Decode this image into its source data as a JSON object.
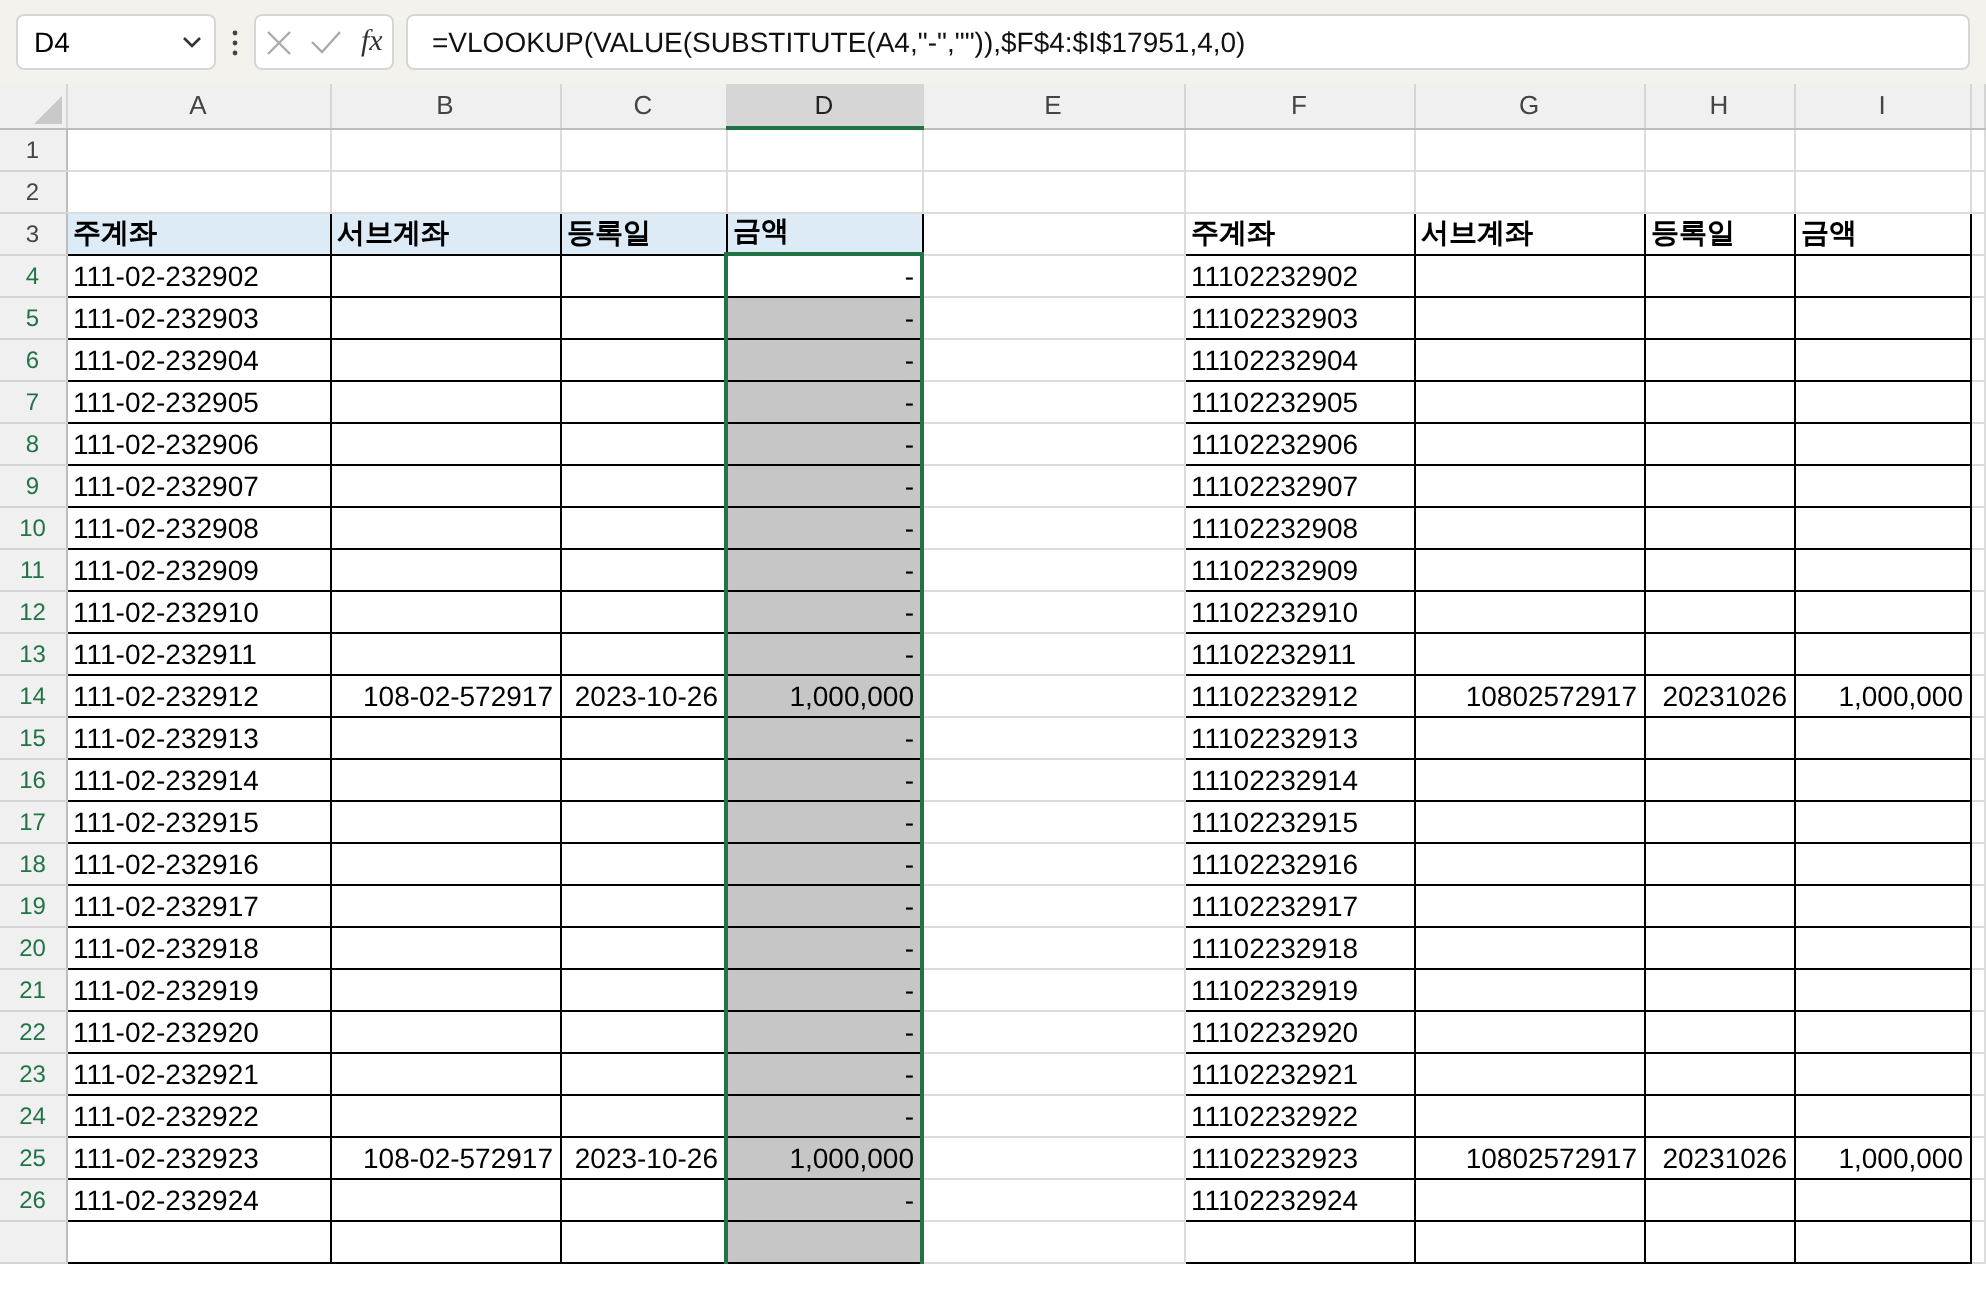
{
  "formula_bar": {
    "name_box": "D4",
    "fx_label": "fx",
    "formula": "=VLOOKUP(VALUE(SUBSTITUTE(A4,\"-\",\"\")),$F$4:$I$17951,4,0)"
  },
  "columns": [
    {
      "letter": "A",
      "selected": false
    },
    {
      "letter": "B",
      "selected": false
    },
    {
      "letter": "C",
      "selected": false
    },
    {
      "letter": "D",
      "selected": true
    },
    {
      "letter": "E",
      "selected": false
    },
    {
      "letter": "F",
      "selected": false
    },
    {
      "letter": "G",
      "selected": false
    },
    {
      "letter": "H",
      "selected": false
    },
    {
      "letter": "I",
      "selected": false
    }
  ],
  "blank_rows": [
    "1",
    "2"
  ],
  "header_row": {
    "num": "3",
    "left": [
      "주계좌",
      "서브계좌",
      "등록일",
      "금액"
    ],
    "right": [
      "주계좌",
      "서브계좌",
      "등록일",
      "금액"
    ]
  },
  "rows": [
    {
      "num": "4",
      "main": "111-02-232902",
      "sub": "",
      "date": "",
      "amount": "-",
      "selected": true,
      "active": true,
      "f": "11102232902",
      "g": "",
      "h": "",
      "i": ""
    },
    {
      "num": "5",
      "main": "111-02-232903",
      "sub": "",
      "date": "",
      "amount": "-",
      "selected": true,
      "active": false,
      "f": "11102232903",
      "g": "",
      "h": "",
      "i": ""
    },
    {
      "num": "6",
      "main": "111-02-232904",
      "sub": "",
      "date": "",
      "amount": "-",
      "selected": true,
      "active": false,
      "f": "11102232904",
      "g": "",
      "h": "",
      "i": ""
    },
    {
      "num": "7",
      "main": "111-02-232905",
      "sub": "",
      "date": "",
      "amount": "-",
      "selected": true,
      "active": false,
      "f": "11102232905",
      "g": "",
      "h": "",
      "i": ""
    },
    {
      "num": "8",
      "main": "111-02-232906",
      "sub": "",
      "date": "",
      "amount": "-",
      "selected": true,
      "active": false,
      "f": "11102232906",
      "g": "",
      "h": "",
      "i": ""
    },
    {
      "num": "9",
      "main": "111-02-232907",
      "sub": "",
      "date": "",
      "amount": "-",
      "selected": true,
      "active": false,
      "f": "11102232907",
      "g": "",
      "h": "",
      "i": ""
    },
    {
      "num": "10",
      "main": "111-02-232908",
      "sub": "",
      "date": "",
      "amount": "-",
      "selected": true,
      "active": false,
      "f": "11102232908",
      "g": "",
      "h": "",
      "i": ""
    },
    {
      "num": "11",
      "main": "111-02-232909",
      "sub": "",
      "date": "",
      "amount": "-",
      "selected": true,
      "active": false,
      "f": "11102232909",
      "g": "",
      "h": "",
      "i": ""
    },
    {
      "num": "12",
      "main": "111-02-232910",
      "sub": "",
      "date": "",
      "amount": "-",
      "selected": true,
      "active": false,
      "f": "11102232910",
      "g": "",
      "h": "",
      "i": ""
    },
    {
      "num": "13",
      "main": "111-02-232911",
      "sub": "",
      "date": "",
      "amount": "-",
      "selected": true,
      "active": false,
      "f": "11102232911",
      "g": "",
      "h": "",
      "i": ""
    },
    {
      "num": "14",
      "main": "111-02-232912",
      "sub": "108-02-572917",
      "date": "2023-10-26",
      "amount": "1,000,000",
      "selected": true,
      "active": false,
      "f": "11102232912",
      "g": "10802572917",
      "h": "20231026",
      "i": "1,000,000"
    },
    {
      "num": "15",
      "main": "111-02-232913",
      "sub": "",
      "date": "",
      "amount": "-",
      "selected": true,
      "active": false,
      "f": "11102232913",
      "g": "",
      "h": "",
      "i": ""
    },
    {
      "num": "16",
      "main": "111-02-232914",
      "sub": "",
      "date": "",
      "amount": "-",
      "selected": true,
      "active": false,
      "f": "11102232914",
      "g": "",
      "h": "",
      "i": ""
    },
    {
      "num": "17",
      "main": "111-02-232915",
      "sub": "",
      "date": "",
      "amount": "-",
      "selected": true,
      "active": false,
      "f": "11102232915",
      "g": "",
      "h": "",
      "i": ""
    },
    {
      "num": "18",
      "main": "111-02-232916",
      "sub": "",
      "date": "",
      "amount": "-",
      "selected": true,
      "active": false,
      "f": "11102232916",
      "g": "",
      "h": "",
      "i": ""
    },
    {
      "num": "19",
      "main": "111-02-232917",
      "sub": "",
      "date": "",
      "amount": "-",
      "selected": true,
      "active": false,
      "f": "11102232917",
      "g": "",
      "h": "",
      "i": ""
    },
    {
      "num": "20",
      "main": "111-02-232918",
      "sub": "",
      "date": "",
      "amount": "-",
      "selected": true,
      "active": false,
      "f": "11102232918",
      "g": "",
      "h": "",
      "i": ""
    },
    {
      "num": "21",
      "main": "111-02-232919",
      "sub": "",
      "date": "",
      "amount": "-",
      "selected": true,
      "active": false,
      "f": "11102232919",
      "g": "",
      "h": "",
      "i": ""
    },
    {
      "num": "22",
      "main": "111-02-232920",
      "sub": "",
      "date": "",
      "amount": "-",
      "selected": true,
      "active": false,
      "f": "11102232920",
      "g": "",
      "h": "",
      "i": ""
    },
    {
      "num": "23",
      "main": "111-02-232921",
      "sub": "",
      "date": "",
      "amount": "-",
      "selected": true,
      "active": false,
      "f": "11102232921",
      "g": "",
      "h": "",
      "i": ""
    },
    {
      "num": "24",
      "main": "111-02-232922",
      "sub": "",
      "date": "",
      "amount": "-",
      "selected": true,
      "active": false,
      "f": "11102232922",
      "g": "",
      "h": "",
      "i": ""
    },
    {
      "num": "25",
      "main": "111-02-232923",
      "sub": "108-02-572917",
      "date": "2023-10-26",
      "amount": "1,000,000",
      "selected": true,
      "active": false,
      "f": "11102232923",
      "g": "10802572917",
      "h": "20231026",
      "i": "1,000,000"
    },
    {
      "num": "26",
      "main": "111-02-232924",
      "sub": "",
      "date": "",
      "amount": "-",
      "selected": true,
      "active": false,
      "f": "11102232924",
      "g": "",
      "h": "",
      "i": ""
    }
  ]
}
